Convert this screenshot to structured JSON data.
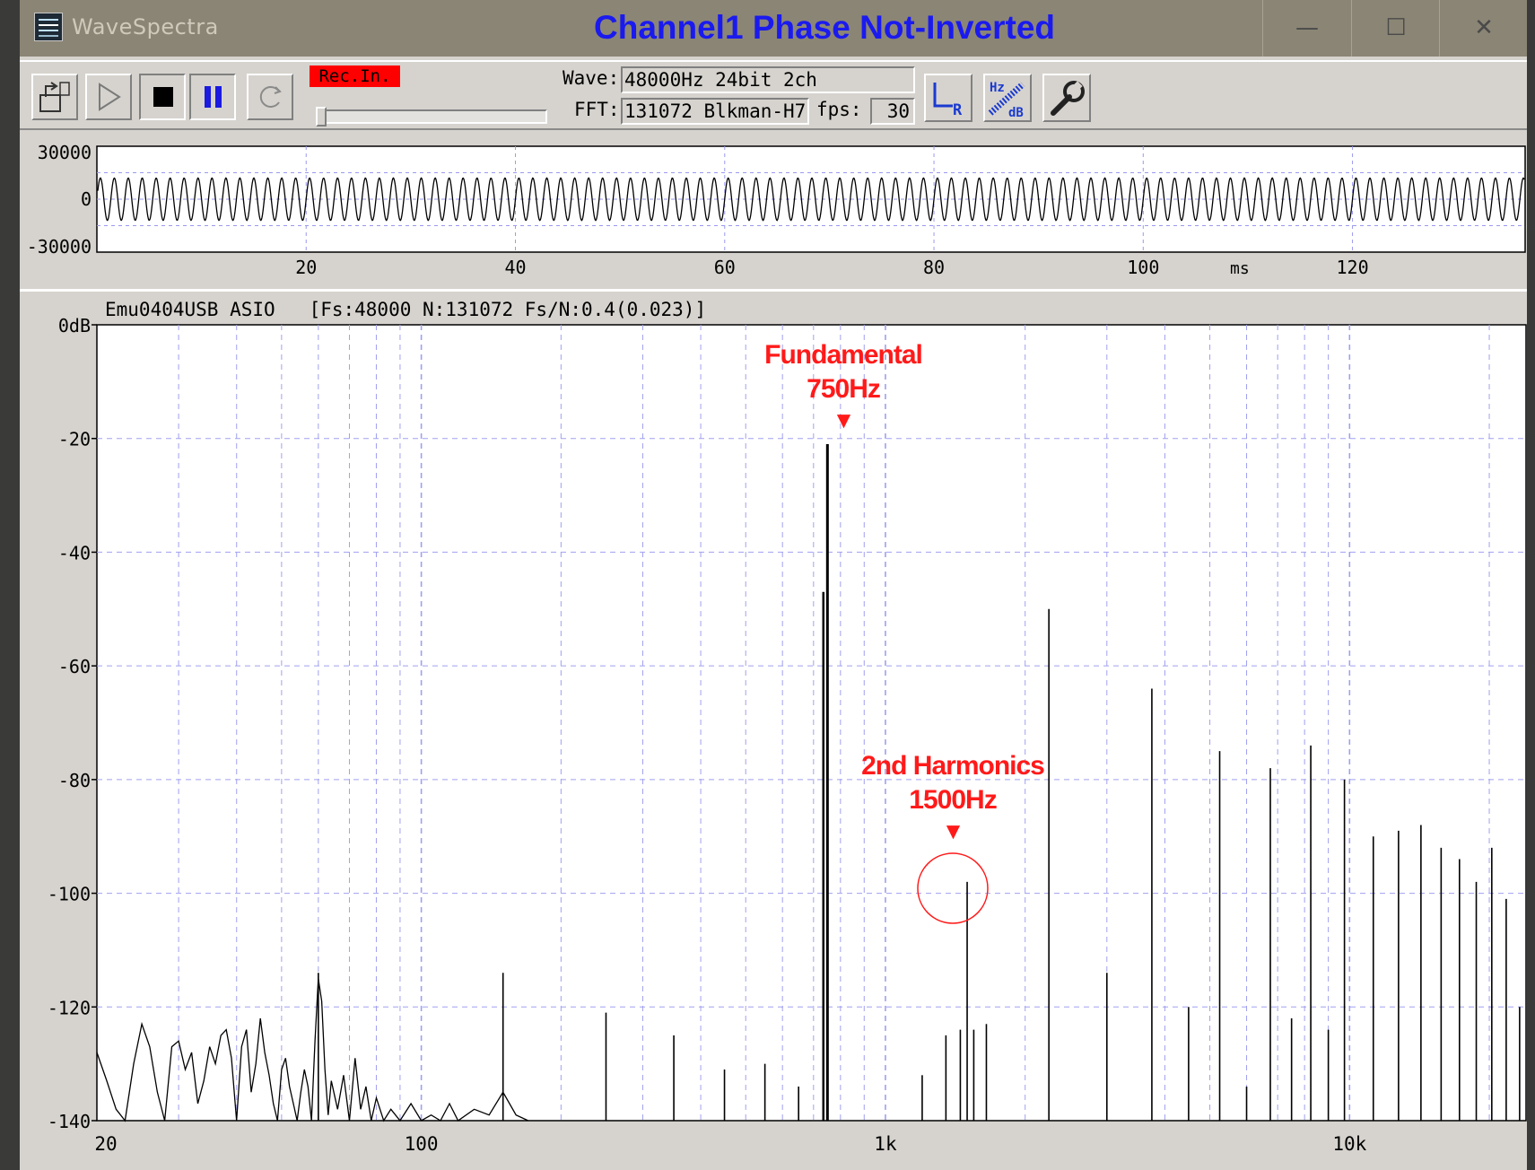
{
  "window": {
    "app_title": "WaveSpectra",
    "overlay_title": "Channel1 Phase Not-Inverted",
    "minimize_glyph": "—",
    "maximize_glyph": "☐",
    "close_glyph": "✕"
  },
  "toolbar": {
    "buttons": [
      "export-icon",
      "play-icon",
      "stop-icon",
      "pause-icon",
      "loop-icon"
    ],
    "rec_label": "Rec.In.",
    "wave_label": "Wave:",
    "wave_value": "48000Hz 24bit 2ch",
    "fft_label": "FFT:",
    "fft_value": "131072 Blkman-H7",
    "fps_label": "fps:",
    "fps_value": "30",
    "lr_icon": "lr-channel-icon",
    "hzdb_icon": "hz-db-scale-icon",
    "settings_icon": "wrench-icon"
  },
  "waveform": {
    "y_ticks": [
      "30000",
      "0",
      "-30000"
    ],
    "y_range": [
      -30000,
      30000
    ],
    "x_ticks": [
      "20",
      "40",
      "60",
      "80",
      "100",
      "120"
    ],
    "x_unit": "ms",
    "x_range_ms": [
      0,
      136.5
    ],
    "signal_freq_hz": 750,
    "amplitude": 12000
  },
  "spectrum": {
    "info": "Emu0404USB ASIO   [Fs:48000 N:131072 Fs/N:0.4(0.023)]",
    "annotation_fundamental": [
      "Fundamental",
      "750Hz"
    ],
    "annotation_harmonic": [
      "2nd Harmonics",
      "1500Hz"
    ],
    "marker_glyph": "▼"
  },
  "chart_data": {
    "type": "bar",
    "x_scale": "log",
    "x_range": [
      20,
      24000
    ],
    "y_range": [
      -140,
      0
    ],
    "y_unit": "dB",
    "y_ticks": [
      "0dB",
      "-20",
      "-40",
      "-60",
      "-80",
      "-100",
      "-120",
      "-140"
    ],
    "x_ticks": [
      "20",
      "100",
      "1k",
      "10k"
    ],
    "grid": true,
    "noise_floor": [
      [
        20,
        -128
      ],
      [
        21,
        -133
      ],
      [
        22,
        -138
      ],
      [
        23,
        -140
      ],
      [
        24,
        -130
      ],
      [
        25,
        -123
      ],
      [
        26,
        -127
      ],
      [
        27,
        -135
      ],
      [
        28,
        -140
      ],
      [
        29,
        -127
      ],
      [
        30,
        -126
      ],
      [
        31,
        -131
      ],
      [
        32,
        -128
      ],
      [
        33,
        -137
      ],
      [
        34,
        -133
      ],
      [
        35,
        -127
      ],
      [
        36,
        -130
      ],
      [
        37,
        -125
      ],
      [
        38,
        -124
      ],
      [
        39,
        -129
      ],
      [
        40,
        -140
      ],
      [
        41,
        -127
      ],
      [
        42,
        -124
      ],
      [
        43,
        -135
      ],
      [
        44,
        -130
      ],
      [
        45,
        -122
      ],
      [
        46,
        -128
      ],
      [
        47,
        -132
      ],
      [
        48,
        -137
      ],
      [
        49,
        -140
      ],
      [
        50,
        -131
      ],
      [
        51,
        -129
      ],
      [
        52,
        -134
      ],
      [
        53,
        -137
      ],
      [
        54,
        -140
      ],
      [
        55,
        -135
      ],
      [
        56,
        -131
      ],
      [
        57,
        -134
      ],
      [
        58,
        -140
      ],
      [
        59,
        -126
      ],
      [
        60,
        -115
      ],
      [
        61,
        -119
      ],
      [
        62,
        -131
      ],
      [
        63,
        -139
      ],
      [
        64,
        -133
      ],
      [
        66,
        -138
      ],
      [
        68,
        -132
      ],
      [
        70,
        -140
      ],
      [
        72,
        -129
      ],
      [
        74,
        -138
      ],
      [
        76,
        -134
      ],
      [
        78,
        -140
      ],
      [
        80,
        -136
      ],
      [
        83,
        -140
      ],
      [
        86,
        -138
      ],
      [
        90,
        -140
      ],
      [
        95,
        -137
      ],
      [
        100,
        -140
      ],
      [
        105,
        -139
      ],
      [
        110,
        -140
      ],
      [
        115,
        -137
      ],
      [
        120,
        -140
      ],
      [
        130,
        -138
      ],
      [
        140,
        -139
      ],
      [
        150,
        -135
      ],
      [
        160,
        -139
      ],
      [
        170,
        -140
      ]
    ],
    "peaks": [
      {
        "freq": 60,
        "db": -114
      },
      {
        "freq": 150,
        "db": -114
      },
      {
        "freq": 250,
        "db": -121
      },
      {
        "freq": 350,
        "db": -125
      },
      {
        "freq": 450,
        "db": -131
      },
      {
        "freq": 550,
        "db": -130
      },
      {
        "freq": 650,
        "db": -134
      },
      {
        "freq": 735,
        "db": -47
      },
      {
        "freq": 750,
        "db": -21
      },
      {
        "freq": 1200,
        "db": -132
      },
      {
        "freq": 1350,
        "db": -125
      },
      {
        "freq": 1450,
        "db": -124
      },
      {
        "freq": 1500,
        "db": -98
      },
      {
        "freq": 1550,
        "db": -124
      },
      {
        "freq": 1650,
        "db": -123
      },
      {
        "freq": 2250,
        "db": -50
      },
      {
        "freq": 3000,
        "db": -114
      },
      {
        "freq": 3750,
        "db": -64
      },
      {
        "freq": 4500,
        "db": -120
      },
      {
        "freq": 5250,
        "db": -75
      },
      {
        "freq": 6000,
        "db": -134
      },
      {
        "freq": 6750,
        "db": -78
      },
      {
        "freq": 7500,
        "db": -122
      },
      {
        "freq": 8250,
        "db": -74
      },
      {
        "freq": 9000,
        "db": -124
      },
      {
        "freq": 9750,
        "db": -80
      },
      {
        "freq": 11250,
        "db": -90
      },
      {
        "freq": 12750,
        "db": -89
      },
      {
        "freq": 14250,
        "db": -88
      },
      {
        "freq": 15750,
        "db": -92
      },
      {
        "freq": 17250,
        "db": -94
      },
      {
        "freq": 18750,
        "db": -98
      },
      {
        "freq": 20250,
        "db": -92
      },
      {
        "freq": 21750,
        "db": -101
      },
      {
        "freq": 23250,
        "db": -120
      }
    ]
  }
}
